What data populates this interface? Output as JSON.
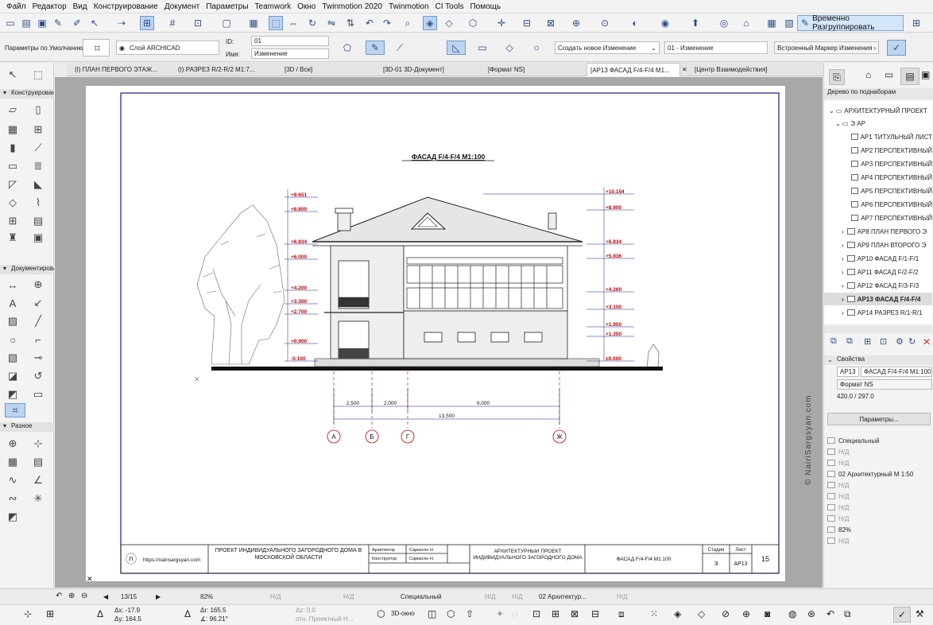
{
  "menu": [
    "Файл",
    "Редактор",
    "Вид",
    "Конструирование",
    "Документ",
    "Параметры",
    "Teamwork",
    "Окно",
    "Twinmotion 2020",
    "Twinmotion",
    "CI Tools",
    "Помощь"
  ],
  "toolbar": {
    "group_button_label": "Временно Разгруппировать"
  },
  "infobar": {
    "defaults_label": "Параметры по Умолчанию",
    "layer_label": "Слой ARCHICAD",
    "id_label": "ID:",
    "id_value": "01",
    "name_label": "Имя:",
    "name_value": "Изменение",
    "change_select": "Создать новое Изменение",
    "change_value": "01 - Изменение",
    "marker_label": "Встроенный Маркер Изменения"
  },
  "tabs": [
    "(I) ПЛАН ПЕРВОГО ЭТАЖ...",
    "(I) РАЗРЕЗ  R/2-R/2  M1:7...",
    "[3D / Все]",
    "[3D-01 3D-Документ]",
    "[Формат NS]",
    "[AP13 ФАСАД  F/4-F/4  M1...",
    "[Центр Взаимодействия]"
  ],
  "toolbox": {
    "section1": "Конструирование",
    "section2": "Документирование",
    "section3": "Разное"
  },
  "drawing": {
    "title": "ФАСАД  F/4-F/4  M1:100",
    "left_levels": [
      "+9.651",
      "+8.800",
      "+6.834",
      "+6.000",
      "+4.200",
      "+3.300",
      "+2.700",
      "+0.900",
      "-0.100"
    ],
    "right_levels": [
      "+10.154",
      "+8.900",
      "+6.834",
      "+5.936",
      "+4.260",
      "+3.100",
      "+1.950",
      "+1.350",
      "±0.000"
    ],
    "dims": [
      "2,500",
      "2,000",
      "9,000",
      "13,500"
    ],
    "axes": [
      "А",
      "Б",
      "Г",
      "Ж"
    ]
  },
  "stamp": {
    "url": "https://nairisargsyan.com",
    "project": "ПРОЕКТ ИНДИВИДУАЛЬНОГО ЗАГОРОДНОГО ДОМА В МОСКОВСКОЙ ОБЛАСТИ",
    "role1": "Архитектор",
    "person1": "Саркисян Н.",
    "role2": "Конструктор",
    "person2": "Саркисян Н.",
    "section": "АРХИТЕКТУРНЫЙ ПРОЕКТ ИНДИВИДУАЛЬНОГО ЗАГОРОДНОГО ДОМА",
    "sheet_name": "ФАСАД  F/4-F/4  M1:100",
    "stage_label": "Стадия",
    "stage_value": "Э",
    "sheet_label": "Лист",
    "sheet_code": "AP13",
    "sheet_number": "15"
  },
  "navigator": {
    "title": "Дерево по поднаборам",
    "items": [
      "АРХИТЕКТУРНЫЙ ПРОЕКТ",
      "Э АР",
      "AP1 ТИТУЛЬНЫЙ ЛИСТ",
      "AP2 ПЕРСПЕКТИВНЫЙ",
      "AP3 ПЕРСПЕКТИВНЫЙ",
      "AP4 ПЕРСПЕКТИВНЫЙ",
      "AP5 ПЕРСПЕКТИВНЫЙ",
      "AP6 ПЕРСПЕКТИВНЫЙ",
      "AP7 ПЕРСПЕКТИВНЫЙ",
      "AP8 ПЛАН ПЕРВОГО Э",
      "AP9 ПЛАН ВТОРОГО Э",
      "AP10 ФАСАД  F/1-F/1",
      "AP11 ФАСАД  F/2-F/2",
      "AP12 ФАСАД  F/3-F/3",
      "AP13 ФАСАД  F/4-F/4",
      "AP14 РАЗРЕЗ  R/1-R/1"
    ]
  },
  "properties": {
    "title": "Свойства",
    "id": "AP13",
    "name": "ФАСАД  F/4-F/4  M1:100",
    "format": "Формат NS",
    "size": "420.0 / 297.0",
    "params_button": "Параметры...",
    "rows": [
      "Специальный",
      "Н/Д",
      "Н/Д",
      "02 Архитектурный М 1:50",
      "Н/Д",
      "Н/Д",
      "Н/Д",
      "Н/Д",
      "82%",
      "Н/Д"
    ]
  },
  "status": {
    "page": "13/15",
    "zoom": "82%",
    "na1": "Н/Д",
    "na2": "Н/Д",
    "special": "Специальный",
    "na3": "Н/Д",
    "na4": "Н/Д",
    "arch": "02 Архитектур...",
    "na5": "Н/Д"
  },
  "coords": {
    "dx": "Δx: -17.9",
    "dy": "Δy: 164.5",
    "dr": "Δr: 165.5",
    "angle": "∡: 96.21°",
    "dz": "Δz: 0.0",
    "ref": "отн. Проектный Н...",
    "view3d": "3D-окно"
  },
  "watermark": "© NairiSargsyan.com"
}
